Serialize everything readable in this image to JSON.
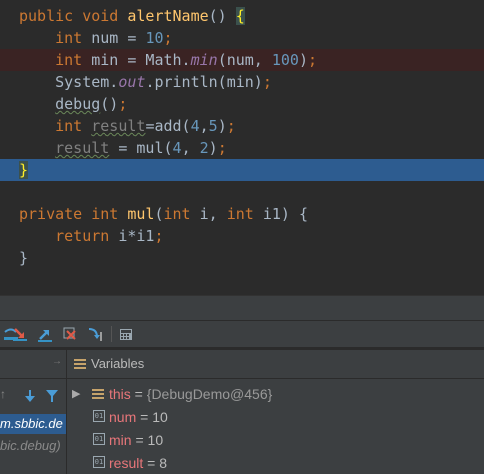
{
  "editor": {
    "lines": [
      {
        "tokens": [
          [
            "kw",
            "public "
          ],
          [
            "kw",
            "void "
          ],
          [
            "fn",
            "alertName"
          ],
          [
            "plain",
            "() "
          ],
          [
            "brace",
            "{"
          ]
        ]
      },
      {
        "tokens": [
          [
            "plain",
            "    "
          ],
          [
            "kw",
            "int "
          ],
          [
            "plain",
            "num = "
          ],
          [
            "num",
            "10"
          ],
          [
            "kw",
            ";"
          ]
        ]
      },
      {
        "tokens": [
          [
            "plain",
            "    "
          ],
          [
            "kw",
            "int "
          ],
          [
            "plain",
            "min = Math."
          ],
          [
            "it",
            "min"
          ],
          [
            "plain",
            "(num, "
          ],
          [
            "num",
            "100"
          ],
          [
            "plain",
            ")"
          ],
          [
            "kw",
            ";"
          ]
        ]
      },
      {
        "tokens": [
          [
            "plain",
            "    System."
          ],
          [
            "it",
            "out"
          ],
          [
            "plain",
            ".println(min)"
          ],
          [
            "kw",
            ";"
          ]
        ]
      },
      {
        "tokens": [
          [
            "plain",
            "    "
          ],
          [
            "wavy",
            "debug"
          ],
          [
            "plain",
            "()"
          ],
          [
            "kw",
            ";"
          ]
        ]
      },
      {
        "tokens": [
          [
            "plain",
            "    "
          ],
          [
            "kw",
            "int "
          ],
          [
            "gwavy",
            "result"
          ],
          [
            "plain",
            "=add("
          ],
          [
            "num",
            "4"
          ],
          [
            "plain",
            ","
          ],
          [
            "num",
            "5"
          ],
          [
            "plain",
            ")"
          ],
          [
            "kw",
            ";"
          ]
        ]
      },
      {
        "tokens": [
          [
            "plain",
            "    "
          ],
          [
            "gwavy",
            "result"
          ],
          [
            "plain",
            " = mul("
          ],
          [
            "num",
            "4"
          ],
          [
            "plain",
            ", "
          ],
          [
            "num",
            "2"
          ],
          [
            "plain",
            ")"
          ],
          [
            "kw",
            ";"
          ]
        ]
      },
      {
        "tokens": [
          [
            "brace",
            "}"
          ]
        ]
      },
      {
        "tokens": []
      },
      {
        "tokens": [
          [
            "kw",
            "private "
          ],
          [
            "kw",
            "int "
          ],
          [
            "fn",
            "mul"
          ],
          [
            "plain",
            "("
          ],
          [
            "kw",
            "int "
          ],
          [
            "plain",
            "i, "
          ],
          [
            "kw",
            "int "
          ],
          [
            "plain",
            "i1) {"
          ]
        ]
      },
      {
        "tokens": [
          [
            "plain",
            "    "
          ],
          [
            "kw",
            "return "
          ],
          [
            "plain",
            "i*i1"
          ],
          [
            "kw",
            ";"
          ]
        ]
      },
      {
        "tokens": [
          [
            "plain",
            "}"
          ]
        ]
      }
    ]
  },
  "frames": {
    "rows": [
      {
        "text": "m.sbbic.de",
        "selected": true
      },
      {
        "text": "bic.debug)",
        "selected": false
      }
    ]
  },
  "variables": {
    "title": "Variables",
    "this_row": {
      "name": "this",
      "value": "{DebugDemo@456}"
    },
    "rows": [
      {
        "name": "num",
        "value": "10"
      },
      {
        "name": "min",
        "value": "10"
      },
      {
        "name": "result",
        "value": "8"
      }
    ]
  },
  "toolbar": {
    "icons": [
      "step-over-icon",
      "step-into-icon",
      "force-step-into-icon",
      "step-out-icon",
      "drop-frame-icon",
      "run-to-cursor-icon",
      "evaluate-icon"
    ]
  },
  "colors": {
    "background": "#2b2b2b",
    "keyword": "#cc7832",
    "function": "#ffc66d",
    "number": "#6897bb",
    "static_field": "#9876aa",
    "execution_line": "#2d5c90",
    "variable_name": "#e8767a"
  }
}
